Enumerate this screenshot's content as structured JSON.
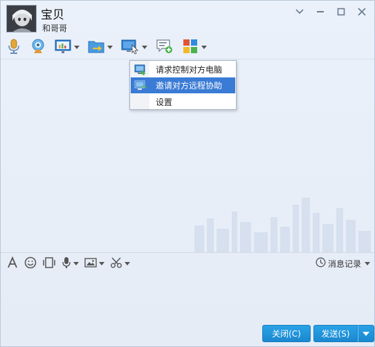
{
  "contact": {
    "name": "宝贝",
    "subname": "和哥哥"
  },
  "window_controls": {
    "menu_icon": "chevron-down-icon",
    "minimize_icon": "minimize-icon",
    "maximize_icon": "maximize-icon",
    "close_icon": "close-icon"
  },
  "toolbar": {
    "tools": [
      {
        "name": "voice-call",
        "icon": "microphone-icon"
      },
      {
        "name": "video-call",
        "icon": "webcam-icon"
      },
      {
        "name": "screen-share",
        "icon": "presentation-icon"
      },
      {
        "name": "file-transfer",
        "icon": "folder-send-icon"
      },
      {
        "name": "remote-assist",
        "icon": "remote-desktop-icon"
      },
      {
        "name": "group-chat",
        "icon": "add-chat-icon"
      },
      {
        "name": "apps",
        "icon": "apps-grid-icon"
      }
    ]
  },
  "remote_menu": {
    "items": [
      {
        "label": "请求控制对方电脑",
        "icon": "remote-control-icon"
      },
      {
        "label": "邀请对方远程协助",
        "icon": "remote-invite-icon"
      },
      {
        "label": "设置",
        "icon": ""
      }
    ],
    "active_index": 1
  },
  "edit_toolbar": {
    "font_icon": "font-icon",
    "emoji_icon": "smiley-icon",
    "shake_icon": "shake-icon",
    "voice_msg_icon": "microphone-icon",
    "image_icon": "image-icon",
    "screenshot_icon": "scissors-icon"
  },
  "history": {
    "label": "消息记录"
  },
  "buttons": {
    "close": "关闭(C)",
    "send": "发送(S)"
  },
  "colors": {
    "accent": "#1a88d0",
    "menu_highlight": "#3a7bd5",
    "window_bg": "#e8eef8"
  }
}
